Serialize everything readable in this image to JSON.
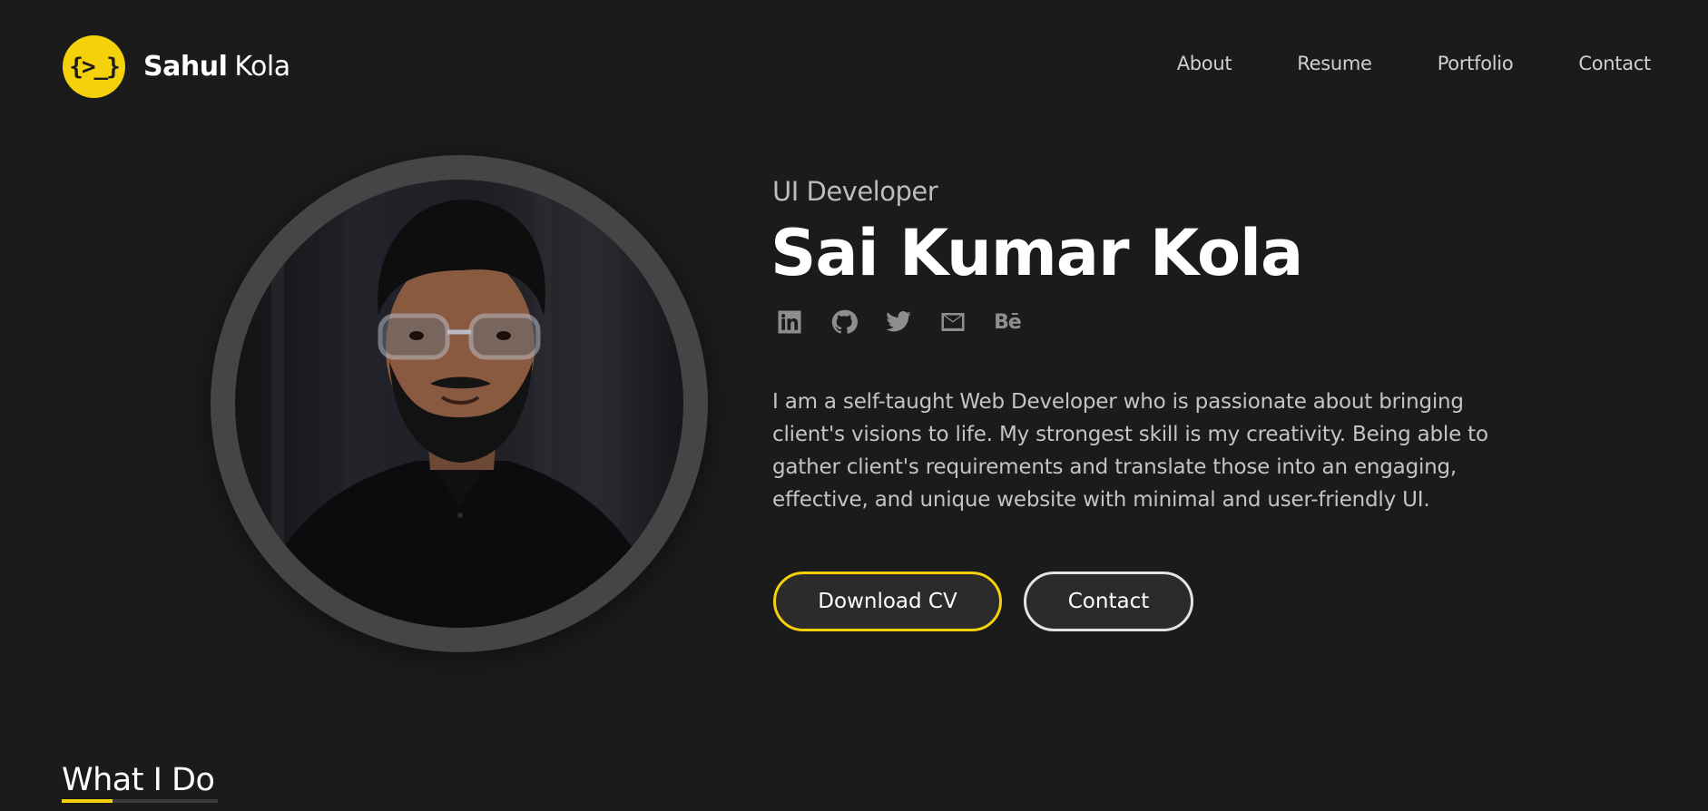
{
  "header": {
    "logo_glyph": "{>_}",
    "brand_first": "Sahul",
    "brand_last": "Kola",
    "nav": [
      "About",
      "Resume",
      "Portfolio",
      "Contact"
    ]
  },
  "hero": {
    "role": "UI Developer",
    "name": "Sai Kumar Kola",
    "socials": [
      {
        "icon": "linkedin-icon"
      },
      {
        "icon": "github-icon"
      },
      {
        "icon": "twitter-icon"
      },
      {
        "icon": "mail-icon"
      },
      {
        "icon": "behance-icon",
        "label": "Bē"
      }
    ],
    "bio": "I am a self-taught Web Developer who is passionate about bringing client's visions to life. My strongest skill is my creativity. Being able to gather client's requirements and translate those into an engaging, effective, and unique website with minimal and user-friendly UI.",
    "cv_button": "Download CV",
    "contact_button": "Contact"
  },
  "section": {
    "title": "What I Do"
  },
  "colors": {
    "background": "#1b1b1b",
    "accent": "#f5d10b",
    "ring": "#454545"
  }
}
